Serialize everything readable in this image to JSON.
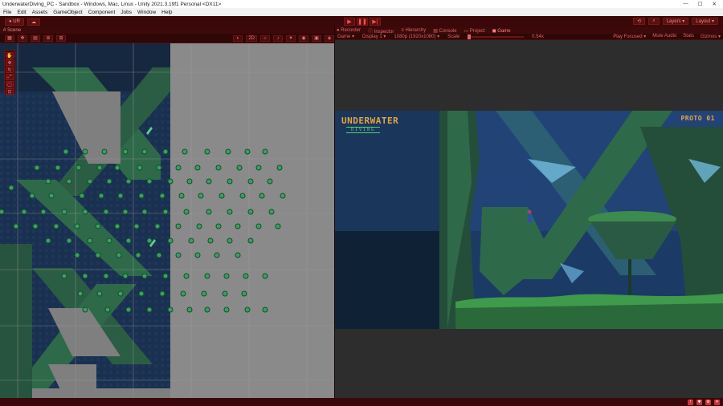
{
  "window": {
    "title": "UnderwaterDiving_PC - Sandbox - Windows, Mac, Linux - Unity 2021.3.19f1 Personal <DX11>"
  },
  "menu": [
    "File",
    "Edit",
    "Assets",
    "GameObject",
    "Component",
    "Jobs",
    "Window",
    "Help"
  ],
  "toolbar": {
    "account_label": "UR",
    "layers_label": "Layers",
    "layout_label": "Layout"
  },
  "scene_panel": {
    "tab": "Scene",
    "mode_2d": "2D"
  },
  "game_panel": {
    "tabs": [
      "Recorder",
      "Inspector",
      "Hierarchy",
      "Console",
      "Project",
      "Game"
    ],
    "active_tab": "Game",
    "game_label": "Game",
    "display": "Display 1",
    "resolution": "1080p (1920x1080)",
    "scale_label": "Scale",
    "scale_value": "0.54x",
    "play_focused": "Play Focused",
    "mute_audio": "Mute Audio",
    "stats": "Stats",
    "gizmos": "Gizmos"
  },
  "game": {
    "logo_title": "UNDERWATER",
    "logo_subtitle": "DIVING",
    "proto_label": "PROTO 01"
  },
  "colors": {
    "editor_tint": "#3a0808",
    "accent": "#ff5050",
    "water": "#1c3a66",
    "foliage": "#2e6a4a",
    "logo": "#e6a540"
  }
}
